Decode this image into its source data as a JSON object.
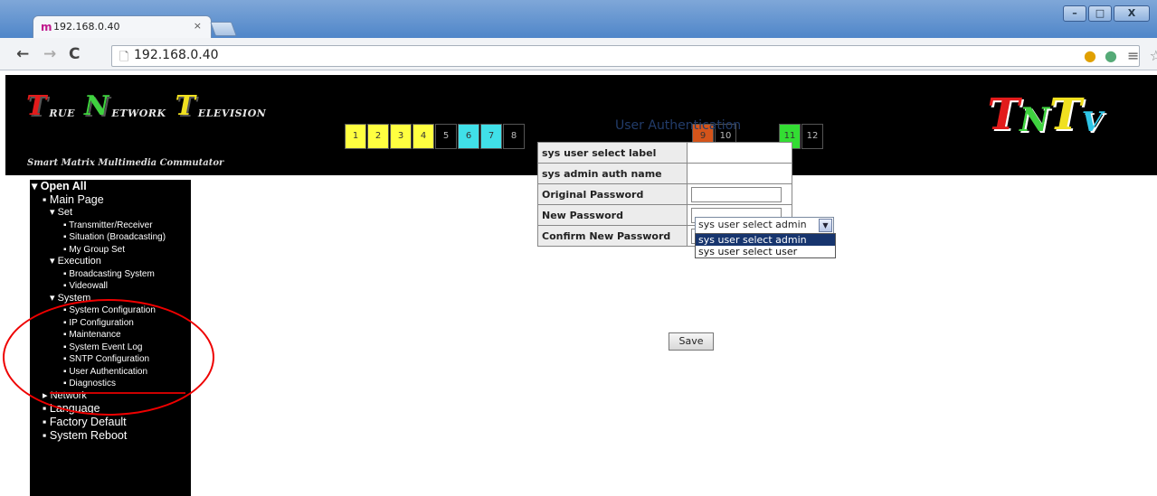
{
  "browser": {
    "tab_title": "192.168.0.40",
    "tab_close": "×",
    "url": "192.168.0.40",
    "window_controls": [
      "–",
      "□",
      "X"
    ],
    "nav": {
      "back": "←",
      "forward": "→",
      "reload": "C"
    }
  },
  "header": {
    "logo": [
      {
        "cap": "T",
        "rest": "RUE",
        "color": "#e21b1b"
      },
      {
        "cap": "N",
        "rest": "ETWORK",
        "color": "#3fd23f"
      },
      {
        "cap": "T",
        "rest": "ELEVISION",
        "color": "#f0e020"
      }
    ],
    "subtitle": "Smart Matrix Multimedia Commutator",
    "channels_group1": [
      {
        "label": "1",
        "color": "#ffff40"
      },
      {
        "label": "2",
        "color": "#ffff40"
      },
      {
        "label": "3",
        "color": "#ffff40"
      },
      {
        "label": "4",
        "color": "#ffff40"
      },
      {
        "label": "5",
        "color": "#000000"
      },
      {
        "label": "6",
        "color": "#40e0e8"
      },
      {
        "label": "7",
        "color": "#40e0e8"
      },
      {
        "label": "8",
        "color": "#000000"
      }
    ],
    "channels_group2": [
      {
        "label": "9",
        "color": "#d4541a"
      },
      {
        "label": "10",
        "color": "#000000"
      }
    ],
    "channels_group3": [
      {
        "label": "11",
        "color": "#33dd33"
      },
      {
        "label": "12",
        "color": "#000000"
      }
    ],
    "brand": [
      {
        "ch": "T",
        "color": "#e21b1b"
      },
      {
        "ch": "N",
        "color": "#3fd23f"
      },
      {
        "ch": "T",
        "color": "#f0e020"
      },
      {
        "ch": "V",
        "color": "#2ec6e8"
      }
    ]
  },
  "sidebar": {
    "open_all": "▾ Open All",
    "main_page": "▪ Main Page",
    "set": "▾ Set",
    "transmitter": "▪ Transmitter/Receiver",
    "situation": "▪ Situation (Broadcasting)",
    "my_group": "▪ My Group Set",
    "execution": "▾ Execution",
    "broadcasting": "▪ Broadcasting System",
    "videowall": "▪ Videowall",
    "system": "▾ System",
    "sys_config": "▪ System Configuration",
    "ip_config": "▪ IP Configuration",
    "maintenance": "▪ Maintenance",
    "event_log": "▪ System Event Log",
    "sntp": "▪ SNTP Configuration",
    "user_auth": "▪ User Authentication",
    "diagnostics": "▪ Diagnostics",
    "network": "▸ Network",
    "language": "▪ Language",
    "factory": "▪ Factory Default",
    "reboot": "▪ System Reboot"
  },
  "content": {
    "title": "User Authentication",
    "rows": {
      "user_select": "sys user select label",
      "admin_name": "sys admin auth name",
      "orig_pw": "Original Password",
      "new_pw": "New Password",
      "confirm_pw": "Confirm New Password"
    },
    "select_value": "sys user select admin",
    "options": [
      "sys user select admin",
      "sys user select user"
    ],
    "save": "Save"
  }
}
